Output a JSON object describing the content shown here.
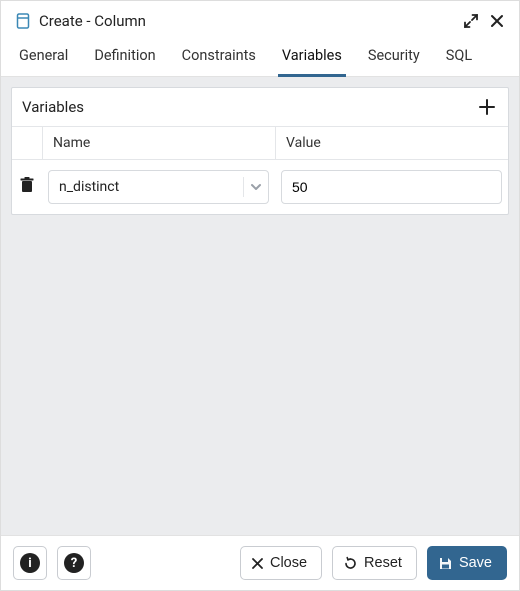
{
  "window": {
    "title": "Create - Column"
  },
  "tabs": {
    "items": [
      {
        "label": "General"
      },
      {
        "label": "Definition"
      },
      {
        "label": "Constraints"
      },
      {
        "label": "Variables"
      },
      {
        "label": "Security"
      },
      {
        "label": "SQL"
      }
    ],
    "active_index": 3
  },
  "panel": {
    "title": "Variables",
    "columns": {
      "name": "Name",
      "value": "Value"
    },
    "rows": [
      {
        "name": "n_distinct",
        "value": "50"
      }
    ]
  },
  "footer": {
    "close": "Close",
    "reset": "Reset",
    "save": "Save"
  },
  "icons": {
    "column": "column-icon",
    "expand": "expand-icon",
    "close": "close-icon",
    "plus": "plus-icon",
    "trash": "trash-icon",
    "chevron_down": "chevron-down-icon",
    "info": "info-icon",
    "help": "help-icon",
    "x": "x-icon",
    "reset": "reset-icon",
    "save": "save-icon"
  }
}
